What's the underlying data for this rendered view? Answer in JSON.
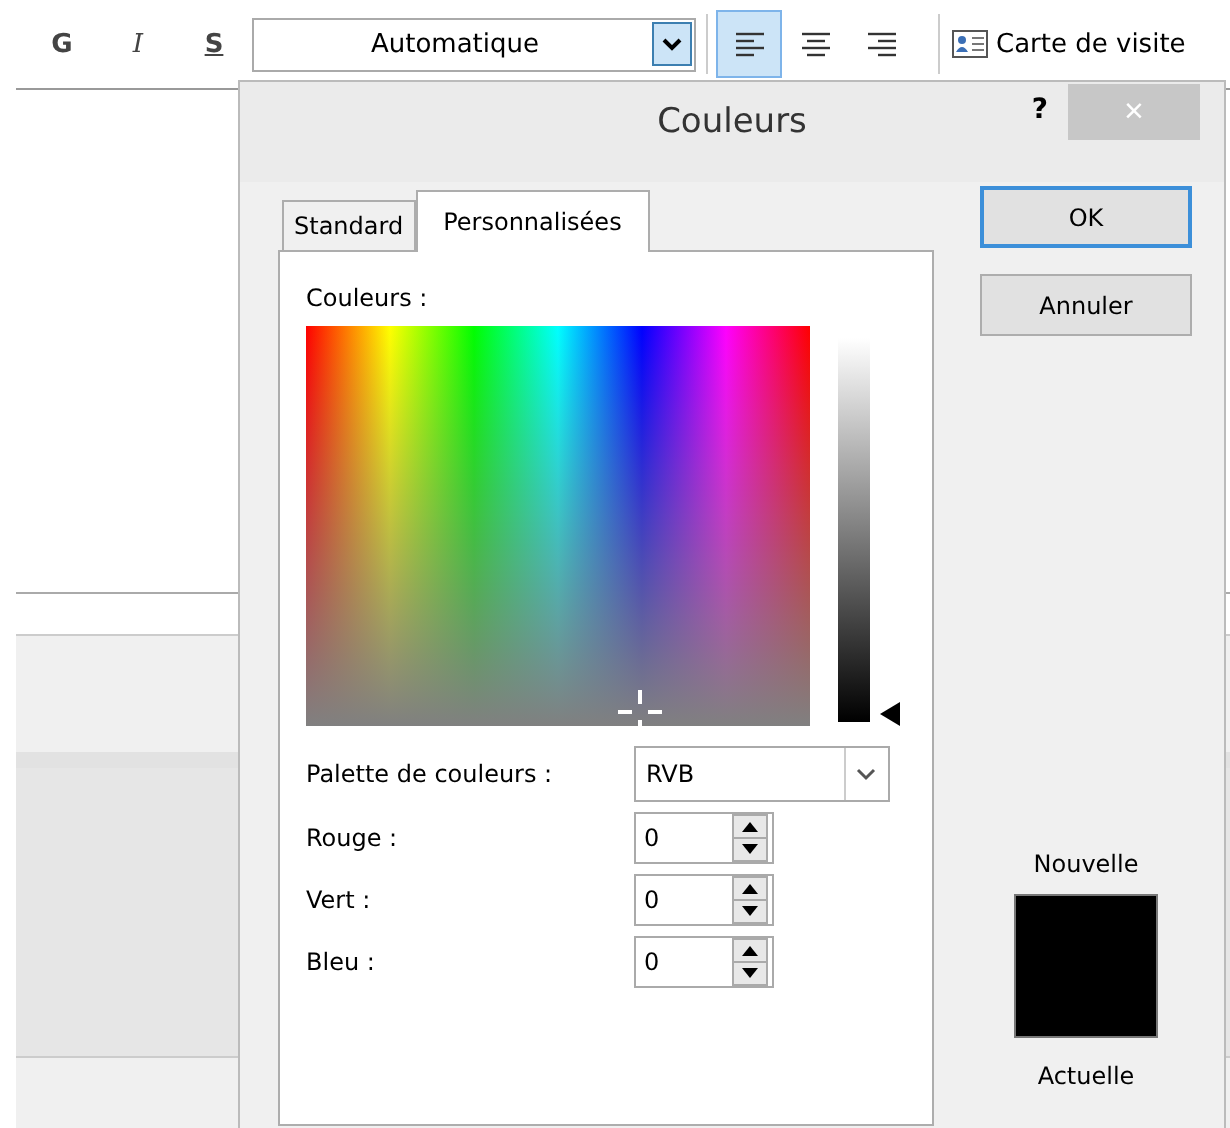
{
  "toolbar": {
    "format_buttons": [
      {
        "label": "G",
        "kind": "bold"
      },
      {
        "label": "I",
        "kind": "italic"
      },
      {
        "label": "S",
        "kind": "underline"
      }
    ],
    "color_dropdown": {
      "value": "Automatique"
    },
    "align_buttons": [
      {
        "kind": "left",
        "selected": true
      },
      {
        "kind": "center",
        "selected": false
      },
      {
        "kind": "right",
        "selected": false
      }
    ],
    "card_button": {
      "label": "Carte de visite"
    }
  },
  "dialog": {
    "title": "Couleurs",
    "help": "?",
    "close": "×",
    "tabs": [
      {
        "label": "Standard",
        "selected": false
      },
      {
        "label": "Personnalisées",
        "selected": true
      }
    ],
    "colors_label": "Couleurs :",
    "luminance": {
      "level": 0
    },
    "palette": {
      "label": "Palette de couleurs :",
      "value": "RVB"
    },
    "channels": [
      {
        "label": "Rouge :",
        "value": "0"
      },
      {
        "label": "Vert :",
        "value": "0"
      },
      {
        "label": "Bleu :",
        "value": "0"
      }
    ],
    "buttons": [
      {
        "label": "OK",
        "default": true
      },
      {
        "label": "Annuler",
        "default": false
      }
    ],
    "new_label": "Nouvelle",
    "current_label": "Actuelle",
    "swatch": {
      "color": "#000000"
    }
  }
}
